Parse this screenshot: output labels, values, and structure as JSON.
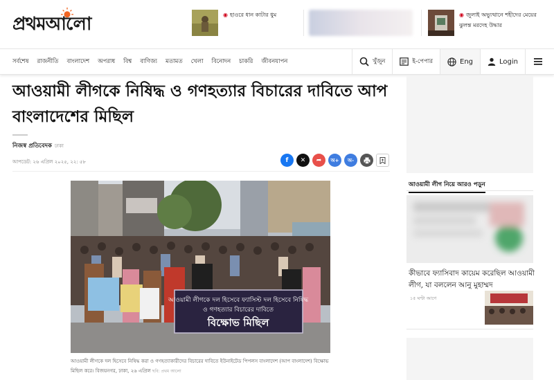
{
  "site": {
    "logo_text": "প্রথমআলো"
  },
  "promos": [
    {
      "text": "হাওরে ধান কাটার ধুম"
    },
    {
      "text": "জুলাই অভ্যুত্থানে শহীদের মেয়ের ঝুলন্ত মরদেহ উদ্ধার"
    }
  ],
  "nav": {
    "items": [
      "সর্বশেষ",
      "রাজনীতি",
      "বাংলাদেশ",
      "অপরাধ",
      "বিশ্ব",
      "বাণিজ্য",
      "মতামত",
      "খেলা",
      "বিনোদন",
      "চাকরি",
      "জীবনযাপন"
    ],
    "search_label": "খুঁজুন",
    "epaper_label": "ই-পেপার",
    "lang_label": "Eng",
    "login_label": "Login"
  },
  "article": {
    "headline_line1": "আওয়ামী লীগকে নিষিদ্ধ ও গণহত্যার বিচারের দাবিতে আপ",
    "headline_line2": "বাংলাদেশের মিছিল",
    "reporter": "নিজস্ব প্রতিবেদক",
    "location": "ঢাকা",
    "updated": "আপডেট: ২৬ এপ্রিল ২০২৫, ২২: ৫৮",
    "share": {
      "colors": {
        "facebook": "#1877f2",
        "x": "#111111",
        "share": "#e8504a",
        "font_large": "#3f7de0",
        "font_small": "#3f7de0",
        "print": "#555555"
      },
      "font_large_label": "অ+",
      "font_small_label": "অ-"
    },
    "photo_banner_line1": "আওয়ামী লীগকে দল হিসেবে ফ্যাসিস্ট দল হিসেবে নিষিদ্ধ",
    "photo_banner_line2": "ও গণহত্যার বিচারের দাবিতে",
    "photo_banner_line3": "বিক্ষোভ মিছিল",
    "caption": "আওয়ামী লীগকে দল হিসেবে নিষিদ্ধ করা ও গণহত্যাকারীদের বিচারের দাবিতে ইউনাইটেড পিপলস বাংলাদেশ (আপ বাংলাদেশ) বিক্ষোভ মিছিল করে। বিজয়নগর, ঢাকা, ২৬ এপ্রিল",
    "credit": "ছবি: প্রথম আলো"
  },
  "sidebar": {
    "more_title": "আওয়ামী লীগ নিয়ে আরও পড়ুন",
    "related_headline": "কীভাবে ফ্যাসিবাদ কায়েম করেছিল আওয়ামী লীগ, যা বললেন আনু মুহাম্মদ",
    "related_time": "১৫ ঘণ্টা আগে"
  },
  "colors": {
    "brand_red": "#d0021b",
    "sun_orange": "#f26522"
  }
}
